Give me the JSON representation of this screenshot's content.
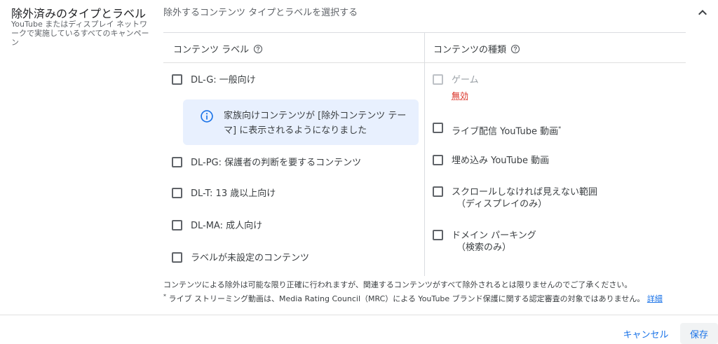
{
  "section": {
    "title": "除外済みのタイプとラベル",
    "description": "YouTube またはディスプレイ ネットワークで実施しているすべてのキャンペーン"
  },
  "main": {
    "title": "除外するコンテンツ タイプとラベルを選択する"
  },
  "labels_column": {
    "header": "コンテンツ ラベル",
    "items": [
      {
        "label": "DL-G: 一般向け",
        "checked": false
      },
      {
        "label": "DL-PG: 保護者の判断を要するコンテンツ",
        "checked": false
      },
      {
        "label": "DL-T: 13 歳以上向け",
        "checked": false
      },
      {
        "label": "DL-MA: 成人向け",
        "checked": false
      },
      {
        "label": "ラベルが未設定のコンテンツ",
        "checked": false
      }
    ],
    "info": "家族向けコンテンツが [除外コンテンツ テーマ] に表示されるようになりました"
  },
  "types_column": {
    "header": "コンテンツの種類",
    "items": [
      {
        "label": "ゲーム",
        "status": "無効",
        "disabled": true
      },
      {
        "label": "ライブ配信 YouTube 動画",
        "marker": "*"
      },
      {
        "label": "埋め込み YouTube 動画"
      },
      {
        "label": "スクロールしなければ見えない範囲",
        "sublabel": "（ディスプレイのみ）"
      },
      {
        "label": "ドメイン パーキング",
        "sublabel": "（検索のみ）"
      }
    ]
  },
  "footnotes": {
    "note1": "コンテンツによる除外は可能な限り正確に行われますが、関連するコンテンツがすべて除外されるとは限りませんのでご了承ください。",
    "marker": "*",
    "note2": " ライブ ストリーミング動画は、Media Rating Council（MRC）による YouTube ブランド保護に関する認定審査の対象ではありません。",
    "link": "詳細"
  },
  "actions": {
    "cancel": "キャンセル",
    "save": "保存"
  },
  "colors": {
    "accent": "#1a73e8",
    "info_bg": "#e8f0fe",
    "error": "#d93025"
  }
}
